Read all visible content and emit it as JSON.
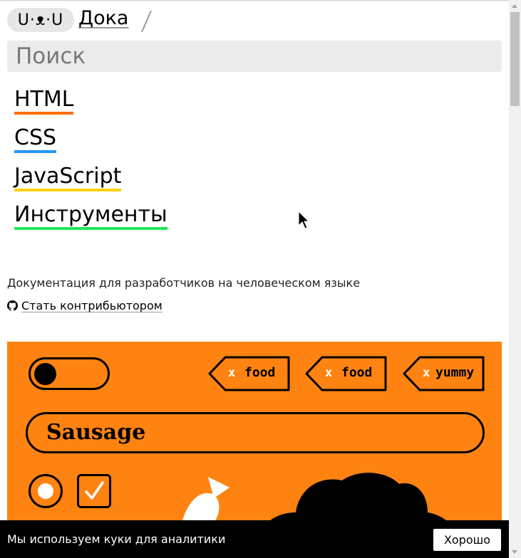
{
  "header": {
    "logo_text": "U·ᴥ·U",
    "brand": "Дока"
  },
  "search": {
    "placeholder": "Поиск",
    "value": ""
  },
  "nav": [
    {
      "label": "HTML",
      "color": "#ff6d00"
    },
    {
      "label": "CSS",
      "color": "#2196f3"
    },
    {
      "label": "JavaScript",
      "color": "#ffd00f"
    },
    {
      "label": "Инструменты",
      "color": "#1ee856"
    }
  ],
  "tagline": "Документация для разработчиков на человеческом языке",
  "contribute": {
    "label": "Стать контрибьютором",
    "icon": "github-icon"
  },
  "promo": {
    "background": "#ff8311",
    "tags": [
      {
        "x": "x",
        "label": "food"
      },
      {
        "x": "x",
        "label": "food"
      },
      {
        "x": "x",
        "label": "yummy"
      }
    ],
    "field_value": "Sausage",
    "toggle_on": false,
    "radio_checked": true,
    "checkbox_checked": true
  },
  "cookie": {
    "message": "Мы используем куки для аналитики",
    "button_label": "Хорошо"
  }
}
